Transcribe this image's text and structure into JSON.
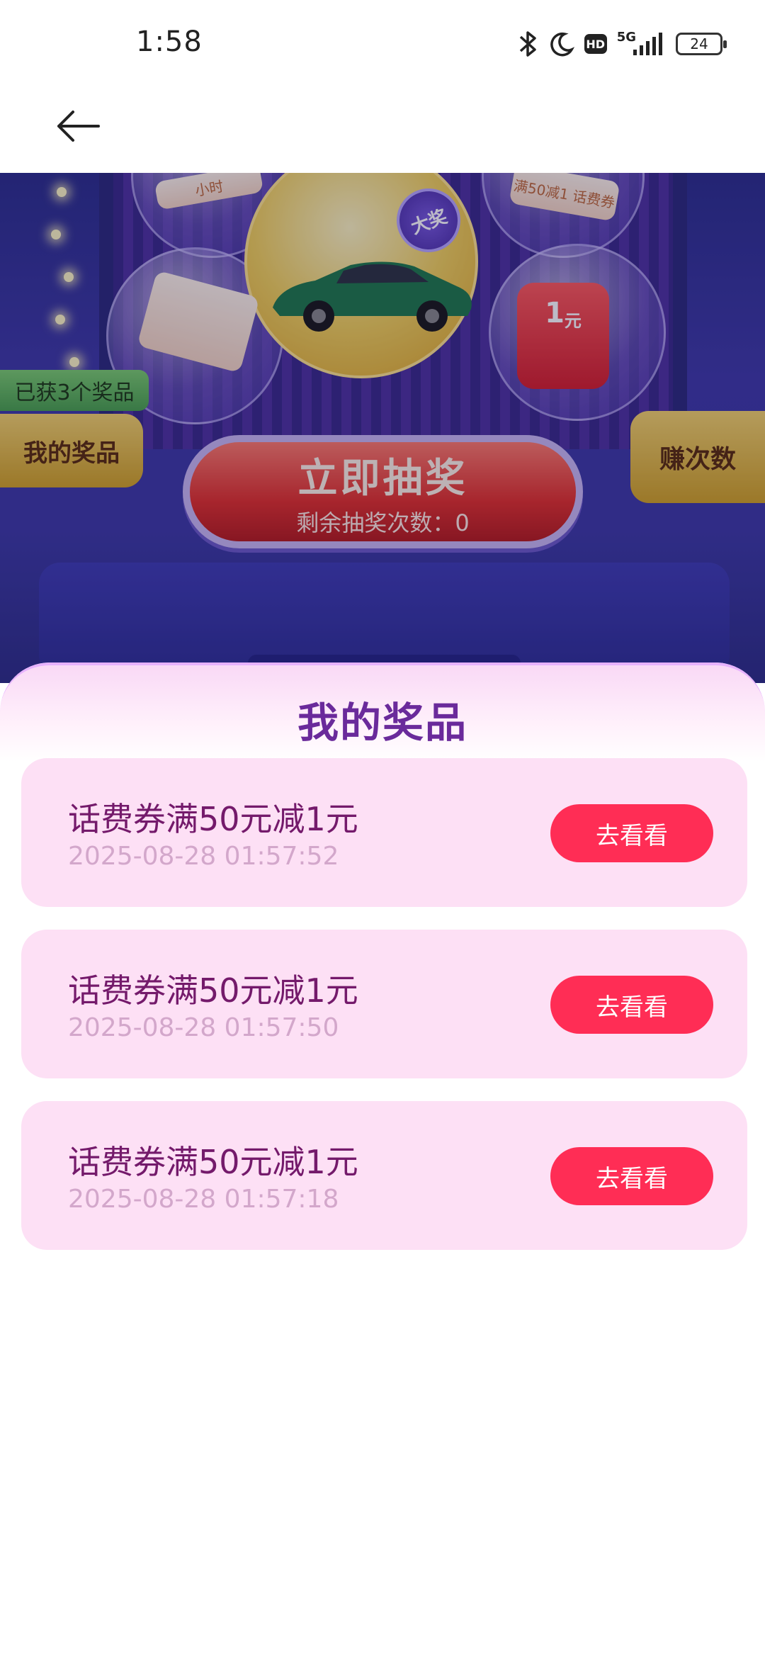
{
  "status_bar": {
    "time": "1:58",
    "network": "5G",
    "hd": "HD",
    "battery": "24",
    "icons": [
      "bluetooth-icon",
      "moon-icon",
      "hd-icon",
      "signal-icon",
      "battery-icon"
    ]
  },
  "nav": {
    "back_icon": "arrow-left-icon"
  },
  "hero": {
    "prize_badge_big": "大奖",
    "prize_card_top_left": "小时",
    "prize_card_top_right": "满50减1 话费券",
    "redpack_value": "1",
    "redpack_unit": "元",
    "got_count_tag": "已获3个奖品",
    "my_prizes_tab": "我的奖品",
    "earn_tab": "赚次数",
    "draw_button": "立即抽奖",
    "draw_remaining": "剩余抽奖次数：0"
  },
  "sheet": {
    "title": "我的奖品",
    "items": [
      {
        "name": "话费券满50元减1元",
        "time": "2025-08-28 01:57:52",
        "action": "去看看"
      },
      {
        "name": "话费券满50元减1元",
        "time": "2025-08-28 01:57:50",
        "action": "去看看"
      },
      {
        "name": "话费券满50元减1元",
        "time": "2025-08-28 01:57:18",
        "action": "去看看"
      }
    ]
  },
  "colors": {
    "accent": "#ff2d55",
    "title_purple": "#6a2a9b",
    "item_bg": "#fde0f5",
    "item_text": "#741a6b",
    "time_text": "#d3a7cb"
  }
}
